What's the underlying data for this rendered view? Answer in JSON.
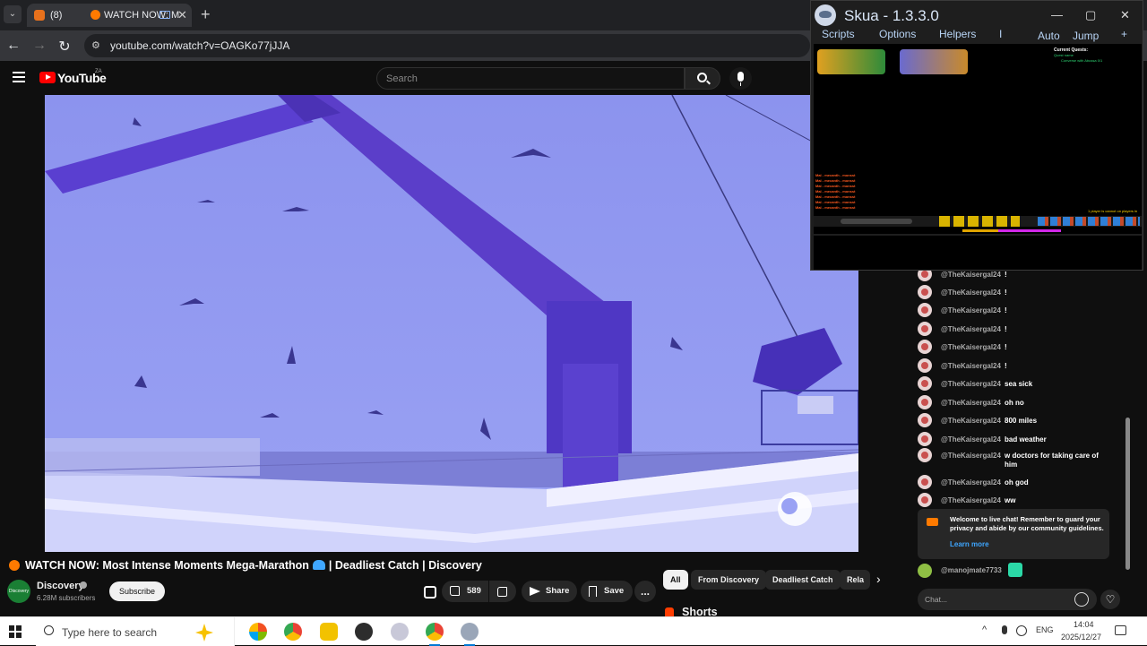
{
  "browser": {
    "tab_count_label": "(8)",
    "tab_title": "WATCH NOW: Most",
    "url": "youtube.com/watch?v=OAGKo77jJJA"
  },
  "youtube": {
    "logo_text": "YouTube",
    "logo_country": "ZA",
    "search_placeholder": "Search"
  },
  "video": {
    "title": "WATCH NOW: Most Intense Moments Mega-Marathon",
    "title_suffix": "| Deadliest Catch | Discovery",
    "channel_name": "Discovery",
    "avatar_text": "Discovery",
    "subscribers": "6.28M subscribers",
    "subscribe_label": "Subscribe",
    "like_count": "589",
    "share_label": "Share",
    "save_label": "Save",
    "more_label": "..."
  },
  "chips": {
    "items": [
      "All",
      "From Discovery",
      "Deadliest Catch",
      "Rela"
    ]
  },
  "shorts_label": "Shorts",
  "chat": {
    "messages": [
      {
        "author": "@TheKaisergal24",
        "text": "!"
      },
      {
        "author": "@TheKaisergal24",
        "text": "!"
      },
      {
        "author": "@TheKaisergal24",
        "text": "!"
      },
      {
        "author": "@TheKaisergal24",
        "text": "!"
      },
      {
        "author": "@TheKaisergal24",
        "text": "!"
      },
      {
        "author": "@TheKaisergal24",
        "text": "!"
      },
      {
        "author": "@TheKaisergal24",
        "text": "sea sick"
      },
      {
        "author": "@TheKaisergal24",
        "text": "oh no"
      },
      {
        "author": "@TheKaisergal24",
        "text": "800 miles"
      },
      {
        "author": "@TheKaisergal24",
        "text": "bad weather"
      },
      {
        "author": "@TheKaisergal24",
        "text": "w doctors for taking care of him"
      },
      {
        "author": "@TheKaisergal24",
        "text": "oh god"
      },
      {
        "author": "@TheKaisergal24",
        "text": "ww"
      }
    ],
    "notice_text": "Welcome to live chat! Remember to guard your privacy and abide by our community guidelines.",
    "notice_link": "Learn more",
    "pinned_author": "@manojmate7733",
    "input_placeholder": "Chat..."
  },
  "skua": {
    "title": "Skua - 1.3.3.0",
    "menu": [
      "Scripts",
      "Options",
      "Helpers",
      "I",
      "Auto",
      "Jump",
      "+"
    ],
    "quest_title": "Current Quests:",
    "quest_line1": "Quest name",
    "quest_line2": "Converse with Abussa 0/1",
    "log_lines": [
      "Mal - mecanth - monsst",
      "Mal - mecanth - monsst",
      "Mal - mecanth - monsst",
      "Mal - mecanth - monsst",
      "Mal - mecanth - monsst",
      "Mal - mecanth - monsst",
      "Mal - mecanth - monsst"
    ],
    "players_text": "1 player is cannot on players in"
  },
  "taskbar": {
    "search_placeholder": "Type here to search",
    "lang": "ENG",
    "time": "14:04",
    "date": "2025/12/27"
  },
  "colors": {
    "yt_red": "#ff0000",
    "live_orange": "#ff7a00",
    "link_blue": "#3ea6ff"
  }
}
